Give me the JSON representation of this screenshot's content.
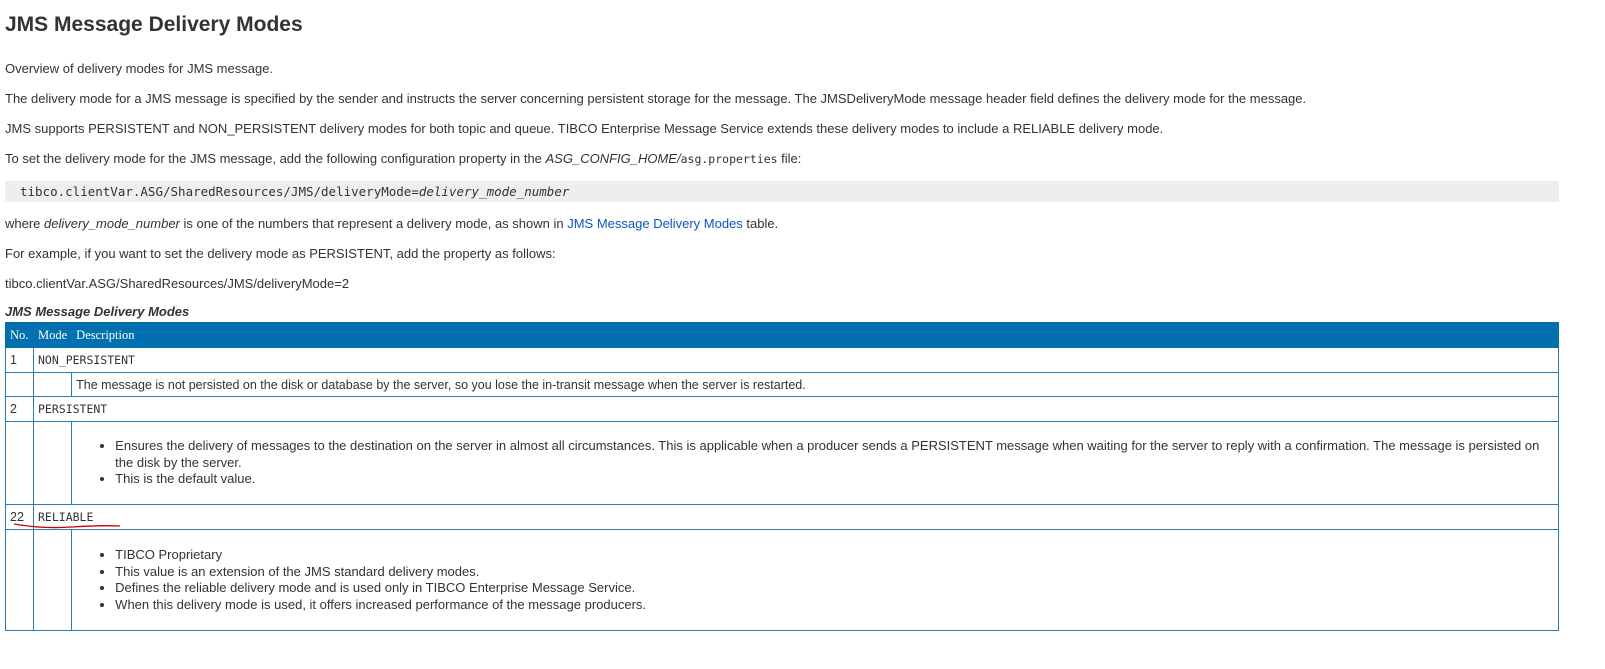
{
  "page": {
    "title": "JMS Message Delivery Modes",
    "overview": "Overview of delivery modes for JMS message.",
    "para1": "The delivery mode for a JMS message is specified by the sender and instructs the server concerning persistent storage for the message. The JMSDeliveryMode message header field defines the delivery mode for the message.",
    "para2": "JMS supports PERSISTENT and NON_PERSISTENT delivery modes for both topic and queue. TIBCO Enterprise Message Service extends these delivery modes to include a RELIABLE delivery mode.",
    "para3_prefix": "To set the delivery mode for the JMS message, add the following configuration property in the ",
    "para3_var": "ASG_CONFIG_HOME",
    "para3_path": "/",
    "para3_file": "asg.properties",
    "para3_suffix": " file:",
    "code_prefix": "tibco.clientVar.ASG/SharedResources/JMS/deliveryMode=",
    "code_var": "delivery_mode_number",
    "where_prefix": "where ",
    "where_var": "delivery_mode_number",
    "where_middle": " is one of the numbers that represent a delivery mode, as shown ",
    "where_in": "in ",
    "where_link": "JMS Message Delivery Modes",
    "where_suffix": " table.",
    "example_intro": "For example, if you want to set the delivery mode as PERSISTENT, add the property as follows:",
    "example_value": "tibco.clientVar.ASG/SharedResources/JMS/deliveryMode=2",
    "table_caption": "JMS Message Delivery Modes"
  },
  "table": {
    "headers": {
      "no": "No.",
      "mode": "Mode",
      "description": "Description"
    },
    "rows": [
      {
        "no": "1",
        "mode": "NON_PERSISTENT",
        "description": "The message is not persisted on the disk or database by the server, so you lose the in-transit message when the server is restarted."
      },
      {
        "no": "2",
        "mode": "PERSISTENT",
        "bullets": [
          "Ensures the delivery of messages to the destination on the server in almost all circumstances. This is applicable when a producer sends a PERSISTENT message when waiting for the server to reply with a confirmation. The message is persisted on the disk by the server.",
          "This is the default value."
        ]
      },
      {
        "no": "22",
        "mode": "RELIABLE",
        "bullets": [
          "TIBCO Proprietary",
          "This value is an extension of the JMS standard delivery modes.",
          "Defines the reliable delivery mode and is used only in TIBCO Enterprise Message Service.",
          "When this delivery mode is used, it offers increased performance of the message producers."
        ]
      }
    ]
  },
  "colors": {
    "table_header": "#0070b0",
    "link": "#0b54d4",
    "annotation": "#cc0000"
  }
}
